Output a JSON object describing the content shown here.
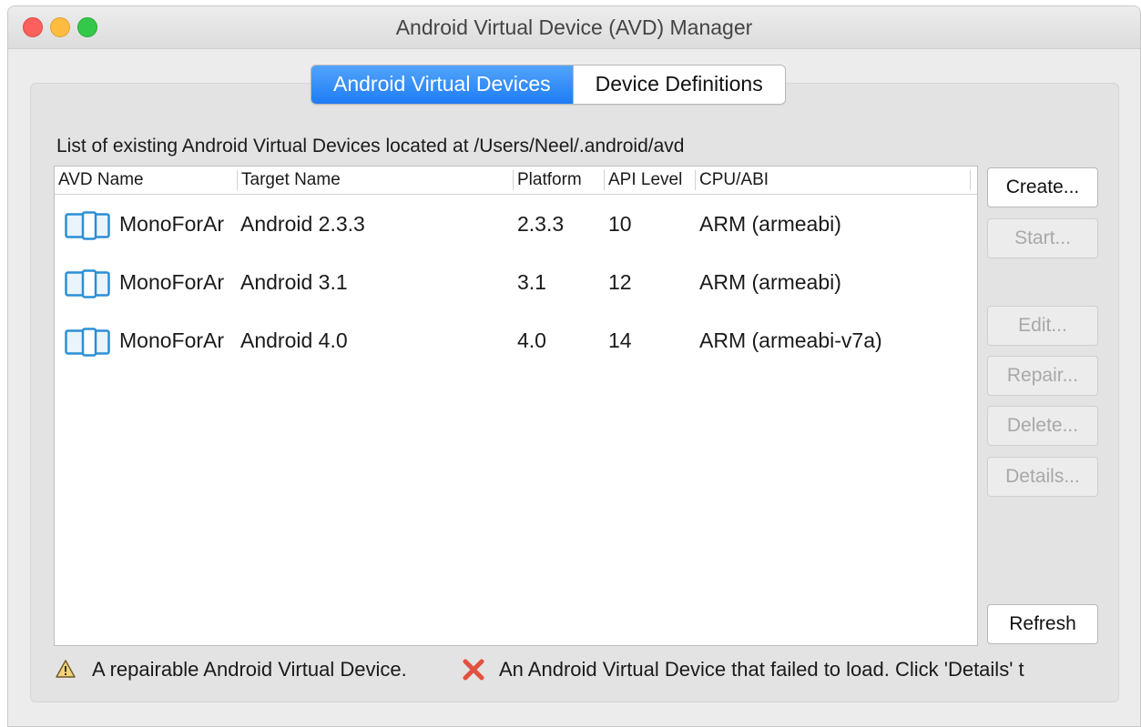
{
  "window": {
    "title": "Android Virtual Device (AVD) Manager"
  },
  "tabs": [
    {
      "label": "Android Virtual Devices",
      "active": true
    },
    {
      "label": "Device Definitions",
      "active": false
    }
  ],
  "description": "List of existing Android Virtual Devices located at /Users/Neel/.android/avd",
  "table": {
    "columns": [
      "AVD Name",
      "Target Name",
      "Platform",
      "API Level",
      "CPU/ABI"
    ],
    "rows": [
      {
        "icon": "avd-device-icon",
        "avd_name": "MonoForAr",
        "target": "Android 2.3.3",
        "platform": "2.3.3",
        "api": "10",
        "cpu": "ARM (armeabi)"
      },
      {
        "icon": "avd-device-icon",
        "avd_name": "MonoForAr",
        "target": "Android 3.1",
        "platform": "3.1",
        "api": "12",
        "cpu": "ARM (armeabi)"
      },
      {
        "icon": "avd-device-icon",
        "avd_name": "MonoForAr",
        "target": "Android 4.0",
        "platform": "4.0",
        "api": "14",
        "cpu": "ARM (armeabi-v7a)"
      }
    ]
  },
  "buttons": {
    "create": {
      "label": "Create...",
      "enabled": true
    },
    "start": {
      "label": "Start...",
      "enabled": false
    },
    "edit": {
      "label": "Edit...",
      "enabled": false
    },
    "repair": {
      "label": "Repair...",
      "enabled": false
    },
    "delete": {
      "label": "Delete...",
      "enabled": false
    },
    "details": {
      "label": "Details...",
      "enabled": false
    },
    "refresh": {
      "label": "Refresh",
      "enabled": true
    }
  },
  "legend": {
    "repairable_text": "A repairable Android Virtual Device.",
    "failed_text": "An Android Virtual Device that failed to load. Click 'Details' t",
    "repairable_icon": "warning-icon",
    "failed_icon": "error-x-icon"
  },
  "colors": {
    "accent_tab": "#1e7cf5",
    "device_icon": "#2a8fd6",
    "error_icon": "#e2503f",
    "close": "#fc605c",
    "minimize": "#fdbc40",
    "maximize": "#34c84a"
  }
}
